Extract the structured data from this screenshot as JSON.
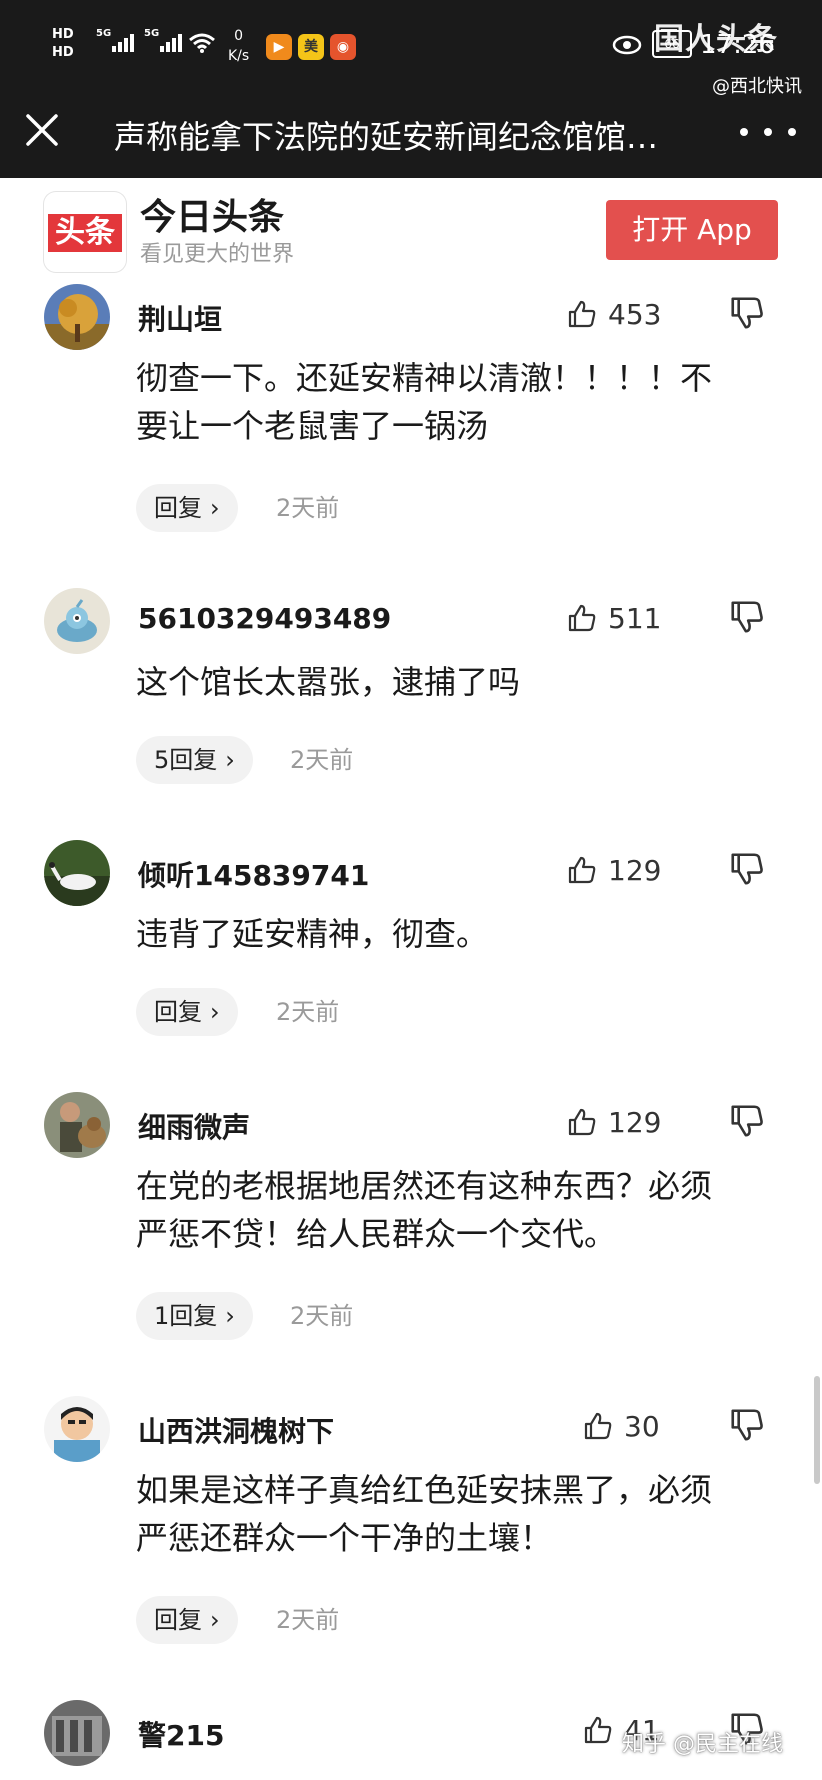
{
  "status_bar": {
    "hd1": "HD",
    "hd2": "HD",
    "net1": "5G",
    "net2": "5G",
    "speed_value": "0",
    "speed_unit": "K/s",
    "app_icon_2": "美",
    "battery": "66",
    "time": "17:26"
  },
  "watermark": {
    "top": "国人头条",
    "top_sub": "@西北快讯",
    "bottom": "知乎 @民主在线"
  },
  "header": {
    "title": "声称能拿下法院的延安新闻纪念馆馆…"
  },
  "banner": {
    "app_logo_text": "头条",
    "app_name": "今日头条",
    "slogan": "看见更大的世界",
    "open_button": "打开 App"
  },
  "comments": [
    {
      "username": "荆山垣",
      "likes": "453",
      "lines": [
        "彻查一下。还延安精神以清澈！！！！不",
        "要让一个老鼠害了一锅汤"
      ],
      "reply_label": "回复",
      "time": "2天前"
    },
    {
      "username": "5610329493489",
      "likes": "511",
      "lines": [
        "这个馆长太嚣张，逮捕了吗"
      ],
      "reply_label": "5回复",
      "time": "2天前"
    },
    {
      "username": "倾听145839741",
      "likes": "129",
      "lines": [
        "违背了延安精神，彻查。"
      ],
      "reply_label": "回复",
      "time": "2天前"
    },
    {
      "username": "细雨微声",
      "likes": "129",
      "lines": [
        "在党的老根据地居然还有这种东西？必须",
        "严惩不贷！给人民群众一个交代。"
      ],
      "reply_label": "1回复",
      "time": "2天前"
    },
    {
      "username": "山西洪洞槐树下",
      "likes": "30",
      "lines": [
        "如果是这样子真给红色延安抹黑了，必须",
        "严惩还群众一个干净的土壤！"
      ],
      "reply_label": "回复",
      "time": "2天前"
    },
    {
      "username": "警215",
      "likes": "41"
    }
  ],
  "colors": {
    "header_bg": "#1a1a1a",
    "brand_red": "#e3373b",
    "open_button": "#e3504e",
    "muted_text": "#9a9a9a",
    "reply_pill_bg": "#f2f2f2"
  },
  "icons": {
    "close": "close-icon",
    "more": "more-dots-icon",
    "like": "thumbs-up-icon",
    "dislike": "thumbs-down-icon",
    "reply_chevron": "chevron-right-icon"
  }
}
